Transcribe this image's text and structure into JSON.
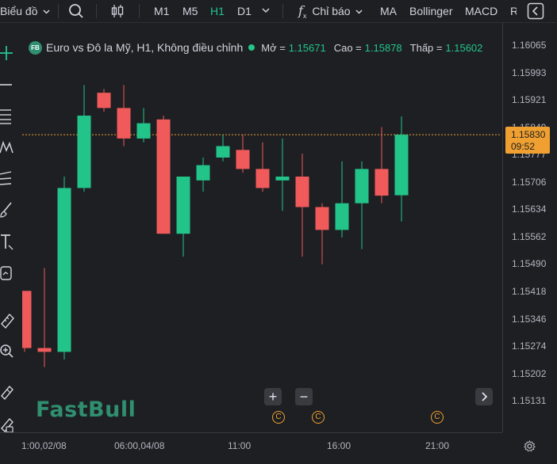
{
  "toolbar": {
    "chart_menu": "Biểu đồ",
    "timeframes": [
      "M1",
      "M5",
      "H1",
      "D1"
    ],
    "active_timeframe": "H1",
    "indicators_label": "Chỉ báo",
    "ma_label": "MA",
    "bollinger_label": "Bollinger",
    "macd_label": "MACD",
    "overflow_label": "R"
  },
  "legend": {
    "badge": "FB",
    "title": "Euro vs Đô la Mỹ, H1, Không điều chỉnh",
    "open_label": "Mở =",
    "open_value": "1.15671",
    "high_label": "Cao =",
    "high_value": "1.15878",
    "low_label": "Thấp =",
    "low_value": "1.15602"
  },
  "price_scale": {
    "labels": [
      "1.16065",
      "1.15993",
      "1.15921",
      "1.15849",
      "1.15777",
      "1.15706",
      "1.15634",
      "1.15562",
      "1.15490",
      "1.15418",
      "1.15346",
      "1.15274",
      "1.15202",
      "1.15131"
    ],
    "current_price": "1.15830",
    "countdown": "09:52"
  },
  "time_scale": {
    "labels": [
      "1:00,02/08",
      "06:00,04/08",
      "11:00",
      "16:00",
      "21:00"
    ]
  },
  "watermark": "FastBull",
  "event_marker_symbol": "C",
  "colors": {
    "up": "#22c48a",
    "down": "#f05a5a",
    "accent": "#f0a030",
    "background": "#1e1f23"
  },
  "chart_data": {
    "type": "candlestick",
    "x_label": "",
    "y_label": "",
    "ylim": [
      1.151,
      1.161
    ],
    "current_price": 1.1583,
    "candles": [
      {
        "o": 1.1542,
        "h": 1.1542,
        "l": 1.1526,
        "c": 1.1527
      },
      {
        "o": 1.1527,
        "h": 1.1548,
        "l": 1.1522,
        "c": 1.1526
      },
      {
        "o": 1.1526,
        "h": 1.1572,
        "l": 1.1524,
        "c": 1.1569
      },
      {
        "o": 1.1569,
        "h": 1.1596,
        "l": 1.1568,
        "c": 1.1588
      },
      {
        "o": 1.1594,
        "h": 1.1595,
        "l": 1.1589,
        "c": 1.159
      },
      {
        "o": 1.159,
        "h": 1.1596,
        "l": 1.158,
        "c": 1.1582
      },
      {
        "o": 1.1582,
        "h": 1.159,
        "l": 1.1581,
        "c": 1.1586
      },
      {
        "o": 1.1587,
        "h": 1.1588,
        "l": 1.1557,
        "c": 1.1557
      },
      {
        "o": 1.1557,
        "h": 1.1572,
        "l": 1.1551,
        "c": 1.1572
      },
      {
        "o": 1.1571,
        "h": 1.1577,
        "l": 1.1568,
        "c": 1.1575
      },
      {
        "o": 1.1577,
        "h": 1.1583,
        "l": 1.1576,
        "c": 1.158
      },
      {
        "o": 1.1579,
        "h": 1.1583,
        "l": 1.1573,
        "c": 1.1574
      },
      {
        "o": 1.1574,
        "h": 1.1581,
        "l": 1.1568,
        "c": 1.1569
      },
      {
        "o": 1.1571,
        "h": 1.1582,
        "l": 1.1563,
        "c": 1.1572
      },
      {
        "o": 1.1572,
        "h": 1.1578,
        "l": 1.1551,
        "c": 1.1564
      },
      {
        "o": 1.1564,
        "h": 1.1565,
        "l": 1.1549,
        "c": 1.1558
      },
      {
        "o": 1.1558,
        "h": 1.1576,
        "l": 1.1556,
        "c": 1.1565
      },
      {
        "o": 1.1565,
        "h": 1.1576,
        "l": 1.1553,
        "c": 1.1574
      },
      {
        "o": 1.1574,
        "h": 1.1585,
        "l": 1.1565,
        "c": 1.1567
      },
      {
        "o": 1.15671,
        "h": 1.15878,
        "l": 1.15602,
        "c": 1.1583
      }
    ]
  }
}
